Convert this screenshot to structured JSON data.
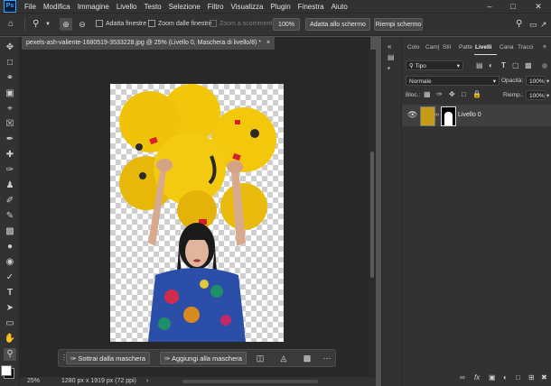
{
  "app": {
    "logo": "Ps",
    "menu": [
      "File",
      "Modifica",
      "Immagine",
      "Livello",
      "Testo",
      "Selezione",
      "Filtro",
      "Visualizza",
      "Plugin",
      "Finestra",
      "Aiuto"
    ],
    "window_controls": [
      "minimize-icon",
      "maximize-icon",
      "close-icon"
    ]
  },
  "options": {
    "home_icon": "home-icon",
    "zoom_tool_icon": "zoom-icon",
    "zoom_in_icon": "zoom-in-icon",
    "zoom_out_icon": "zoom-out-icon",
    "adatta_finestre": "Adatta finestre",
    "zoom_dalle_finestre": "Zoom dalle finestre",
    "zoom_scorrimento": "Zoom a scorrimento",
    "zoom_value": "100%",
    "adatta_schermo": "Adatta allo schermo",
    "riempi_schermo": "Riempi schermo",
    "search_icon": "search-icon",
    "workspace_icon": "workspace-icon",
    "share_icon": "share-icon"
  },
  "document": {
    "tab_title": "pexels-ash-valiente-1680519-3533228.jpg @ 25% (Livello 0, Maschera di livello/8) *",
    "tab_close": "×"
  },
  "context_bar": {
    "subtract_label": "Sottrai dalla maschera",
    "add_label": "Aggiungi alla maschera",
    "more": "···"
  },
  "status": {
    "zoom": "25%",
    "doc_size": "1280 px x 1919 px (72 ppi)"
  },
  "layers_panel": {
    "tabs": [
      "Colo",
      "Cam|",
      "Stil",
      "Patte",
      "Livelli",
      "Cana",
      "Tracci"
    ],
    "active_tab": "Livelli",
    "filter_label": "Tipo",
    "blend_mode": "Normale",
    "opacity_label": "Opacità:",
    "opacity_value": "100%",
    "lock_label": "Bloc.:",
    "fill_label": "Riemp.:",
    "fill_value": "100%",
    "layers": [
      {
        "name": "Livello 0",
        "visible": true
      }
    ]
  },
  "colors": {
    "ui_dark": "#323232",
    "canvas_bg": "#282828",
    "accent": "#31a8ff"
  }
}
